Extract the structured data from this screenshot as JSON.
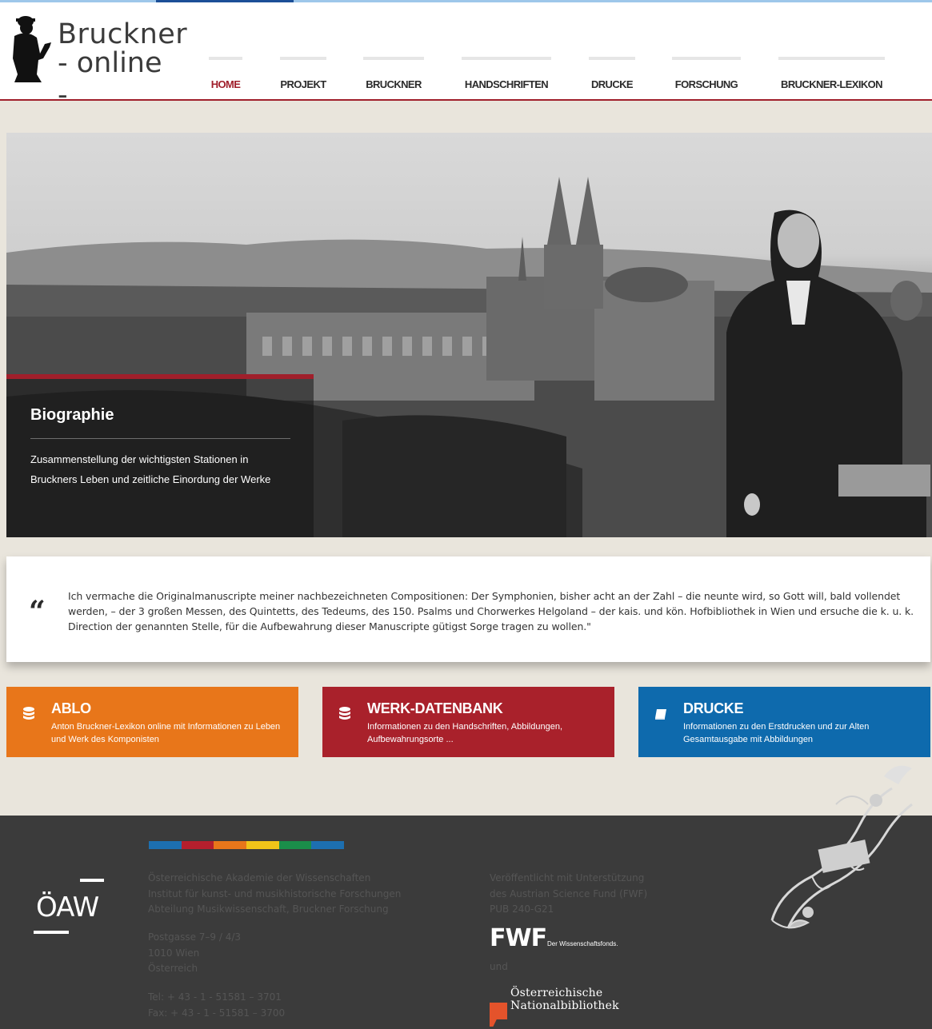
{
  "header": {
    "logo_line1": "Bruckner",
    "logo_line2": "- online -"
  },
  "nav": [
    {
      "label": "HOME",
      "active": true
    },
    {
      "label": "PROJEKT"
    },
    {
      "label": "BRUCKNER"
    },
    {
      "label": "HANDSCHRIFTEN"
    },
    {
      "label": "DRUCKE"
    },
    {
      "label": "FORSCHUNG"
    },
    {
      "label": "BRUCKNER-LEXIKON"
    }
  ],
  "hero": {
    "title": "Biographie",
    "text": "Zusammenstellung der wichtigsten Stationen in Bruckners Leben und zeitliche Einordung der Werke"
  },
  "quote": {
    "icon": "quote-open-icon",
    "text": "Ich vermache die Originalmanuscripte meiner nachbezeichneten Compositionen: Der Symphonien, bisher acht an der Zahl – die neunte wird, so Gott will, bald vollendet werden, – der 3 großen Messen, des Quintetts, des Tedeums, des 150. Psalms und Chorwerkes Helgoland – der kais. und kön. Hofbibliothek in Wien und ersuche die k. u. k. Direction der genannten Stelle, für die Aufbewahrung dieser Manuscripte gütigst Sorge tragen zu wollen.\""
  },
  "tiles": [
    {
      "title": "ABLO",
      "desc": "Anton Bruckner-Lexikon online mit Informationen zu Leben und Werk des Komponisten",
      "color": "#e8761a",
      "icon": "database-icon"
    },
    {
      "title": "WERK-DATENBANK",
      "desc": "Informationen zu den Handschriften, Abbildungen, Aufbewahrungsorte ...",
      "color": "#a9212b",
      "icon": "database-icon"
    },
    {
      "title": "DRUCKE",
      "desc": "Informationen zu den Erstdrucken und zur Alten Gesamtausgabe mit Abbildungen",
      "color": "#0e6aad",
      "icon": "book-icon"
    }
  ],
  "footer": {
    "colorbar": [
      "#1d6fb0",
      "#b51f2d",
      "#e8761a",
      "#f0c419",
      "#1a8e4a",
      "#1d6fb0"
    ],
    "oaw_logo": "ÖAW",
    "institution": [
      "Österreichische Akademie der Wissenschaften",
      "Institut für kunst- und musikhistorische Forschungen",
      "Abteilung Musikwissenschaft, Bruckner Forschung"
    ],
    "address": [
      "Postgasse 7–9 / 4/3",
      "1010 Wien",
      "Österreich"
    ],
    "phone": [
      "Tel: + 43 - 1 - 51581 – 3701",
      "Fax: + 43 - 1 - 51581 – 3700"
    ],
    "funding": [
      "Veröffentlicht mit Unterstützung",
      "des Austrian Science Fund (FWF)",
      "PUB 240-G21"
    ],
    "fwf_logo": "FWF",
    "fwf_tagline": "Der Wissenschaftsfonds.",
    "and": "und",
    "onb_line1": "Österreichische",
    "onb_line2": "Nationalbibliothek"
  }
}
